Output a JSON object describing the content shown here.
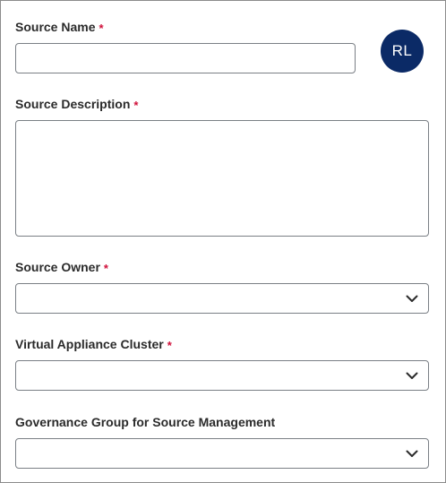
{
  "form": {
    "source_name": {
      "label": "Source Name",
      "required_marker": "*",
      "value": ""
    },
    "source_description": {
      "label": "Source Description",
      "required_marker": "*",
      "value": ""
    },
    "source_owner": {
      "label": "Source Owner",
      "required_marker": "*",
      "selected": ""
    },
    "virtual_appliance_cluster": {
      "label": "Virtual Appliance Cluster",
      "required_marker": "*",
      "selected": ""
    },
    "governance_group": {
      "label": "Governance Group for Source Management",
      "selected": ""
    }
  },
  "avatar": {
    "initials": "RL",
    "color": "#0b2a66"
  },
  "colors": {
    "required": "#d0103a",
    "label": "#2b2b2b",
    "field_border": "#7a7f85"
  }
}
